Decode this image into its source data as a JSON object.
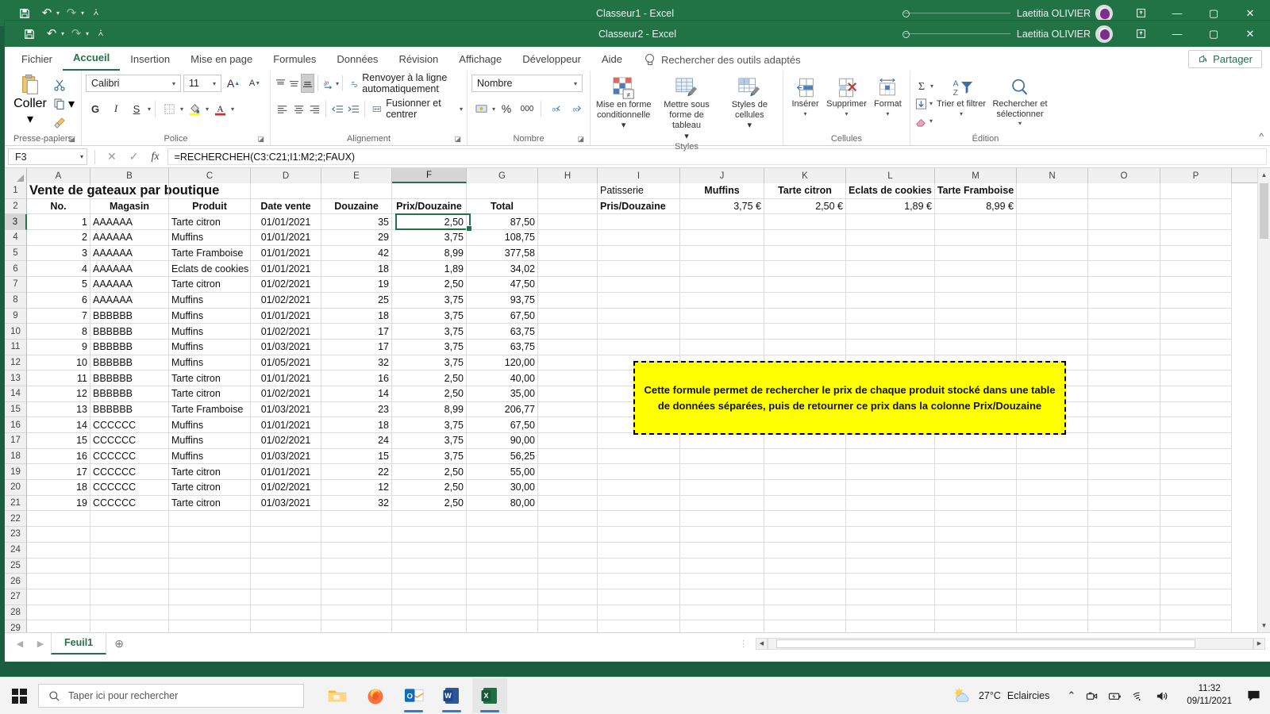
{
  "window_back": {
    "title": "Classeur1  -  Excel",
    "account": "Laetitia OLIVIER"
  },
  "window_front": {
    "title": "Classeur2  -  Excel",
    "account": "Laetitia OLIVIER"
  },
  "qat": {
    "save": "Enregistrer",
    "undo": "Annuler",
    "redo": "Rétablir",
    "more": "Personnaliser la barre d'outils Accès rapide"
  },
  "window_controls": {
    "ribbon_display": "Options d'affichage du ruban",
    "minimize": "Réduire",
    "restore": "Agrandir",
    "close": "Fermer"
  },
  "ribbon": {
    "tabs": [
      {
        "label": "Fichier",
        "active": false
      },
      {
        "label": "Accueil",
        "active": true
      },
      {
        "label": "Insertion",
        "active": false
      },
      {
        "label": "Mise en page",
        "active": false
      },
      {
        "label": "Formules",
        "active": false
      },
      {
        "label": "Données",
        "active": false
      },
      {
        "label": "Révision",
        "active": false
      },
      {
        "label": "Affichage",
        "active": false
      },
      {
        "label": "Développeur",
        "active": false
      },
      {
        "label": "Aide",
        "active": false
      }
    ],
    "tellme": "Rechercher des outils adaptés",
    "share": "Partager",
    "groups": {
      "clipboard": {
        "label": "Presse-papiers",
        "paste": "Coller",
        "cut": "Couper",
        "copy": "Copier",
        "format_painter": "Reproduire la mise en forme"
      },
      "font": {
        "label": "Police",
        "font_name": "Calibri",
        "font_size": "11",
        "grow": "Agrandir la police",
        "shrink": "Réduire la police",
        "bold": "G",
        "italic": "I",
        "underline": "S",
        "borders": "Bordures",
        "fill": "Couleur de remplissage",
        "color": "Couleur de police"
      },
      "alignment": {
        "label": "Alignement",
        "wrap": "Renvoyer à la ligne automatiquement",
        "merge": "Fusionner et centrer",
        "orientation": "Orientation",
        "indent_dec": "Diminuer le retrait",
        "indent_inc": "Augmenter le retrait"
      },
      "number": {
        "label": "Nombre",
        "format": "Nombre",
        "accounting": "Format comptabilité",
        "percent": "%",
        "thousands": "000",
        "dec_add": "Ajouter une décimale",
        "dec_remove": "Réduire les décimales"
      },
      "styles": {
        "label": "Styles",
        "conditional": "Mise en forme conditionnelle",
        "table": "Mettre sous forme de tableau",
        "cell_styles": "Styles de cellules"
      },
      "cells": {
        "label": "Cellules",
        "insert": "Insérer",
        "delete": "Supprimer",
        "format": "Format"
      },
      "editing": {
        "label": "Édition",
        "autosum": "Somme automatique",
        "fill": "Remplissage",
        "clear": "Effacer",
        "sort_filter": "Trier et filtrer",
        "find_select": "Rechercher et sélectionner"
      }
    }
  },
  "formula_bar": {
    "name_box": "F3",
    "cancel": "Annuler",
    "enter": "Entrer",
    "fx": "Insérer une fonction",
    "formula": "=RECHERCHEH(C3:C21;I1:M2;2;FAUX)"
  },
  "grid": {
    "columns": [
      "A",
      "B",
      "C",
      "D",
      "E",
      "F",
      "G",
      "H",
      "I",
      "J",
      "K",
      "L",
      "M",
      "N",
      "O",
      "P"
    ],
    "selected_column": "F",
    "selected_row": 3,
    "selected_cell": "F3",
    "rows": [
      1,
      2,
      3,
      4,
      5,
      6,
      7,
      8,
      9,
      10,
      11,
      12,
      13,
      14,
      15,
      16,
      17,
      18,
      19,
      20,
      21,
      22,
      23,
      24,
      25,
      26,
      27,
      28,
      29
    ],
    "title_cell": "Vente de gateaux par boutique",
    "headers": [
      "No.",
      "Magasin",
      "Produit",
      "Date vente",
      "Douzaine",
      "Prix/Douzaine",
      "Total"
    ],
    "data": [
      [
        "1",
        "AAAAAA",
        "Tarte citron",
        "01/01/2021",
        "35",
        "2,50",
        "87,50"
      ],
      [
        "2",
        "AAAAAA",
        "Muffins",
        "01/01/2021",
        "29",
        "3,75",
        "108,75"
      ],
      [
        "3",
        "AAAAAA",
        "Tarte Framboise",
        "01/01/2021",
        "42",
        "8,99",
        "377,58"
      ],
      [
        "4",
        "AAAAAA",
        "Eclats de cookies",
        "01/01/2021",
        "18",
        "1,89",
        "34,02"
      ],
      [
        "5",
        "AAAAAA",
        "Tarte citron",
        "01/02/2021",
        "19",
        "2,50",
        "47,50"
      ],
      [
        "6",
        "AAAAAA",
        "Muffins",
        "01/02/2021",
        "25",
        "3,75",
        "93,75"
      ],
      [
        "7",
        "BBBBBB",
        "Muffins",
        "01/01/2021",
        "18",
        "3,75",
        "67,50"
      ],
      [
        "8",
        "BBBBBB",
        "Muffins",
        "01/02/2021",
        "17",
        "3,75",
        "63,75"
      ],
      [
        "9",
        "BBBBBB",
        "Muffins",
        "01/03/2021",
        "17",
        "3,75",
        "63,75"
      ],
      [
        "10",
        "BBBBBB",
        "Muffins",
        "01/05/2021",
        "32",
        "3,75",
        "120,00"
      ],
      [
        "11",
        "BBBBBB",
        "Tarte citron",
        "01/01/2021",
        "16",
        "2,50",
        "40,00"
      ],
      [
        "12",
        "BBBBBB",
        "Tarte citron",
        "01/02/2021",
        "14",
        "2,50",
        "35,00"
      ],
      [
        "13",
        "BBBBBB",
        "Tarte Framboise",
        "01/03/2021",
        "23",
        "8,99",
        "206,77"
      ],
      [
        "14",
        "CCCCCC",
        "Muffins",
        "01/01/2021",
        "18",
        "3,75",
        "67,50"
      ],
      [
        "15",
        "CCCCCC",
        "Muffins",
        "01/02/2021",
        "24",
        "3,75",
        "90,00"
      ],
      [
        "16",
        "CCCCCC",
        "Muffins",
        "01/03/2021",
        "15",
        "3,75",
        "56,25"
      ],
      [
        "17",
        "CCCCCC",
        "Tarte citron",
        "01/01/2021",
        "22",
        "2,50",
        "55,00"
      ],
      [
        "18",
        "CCCCCC",
        "Tarte citron",
        "01/02/2021",
        "12",
        "2,50",
        "30,00"
      ],
      [
        "19",
        "CCCCCC",
        "Tarte citron",
        "01/03/2021",
        "32",
        "2,50",
        "80,00"
      ]
    ],
    "lookup_table": {
      "row1": [
        "Patisserie",
        "Muffins",
        "Tarte citron",
        "Eclats de cookies",
        "Tarte Framboise"
      ],
      "row2": [
        "Pris/Douzaine",
        "3,75 €",
        "2,50 €",
        "1,89 €",
        "8,99 €"
      ]
    },
    "annotation": "Cette formule permet de rechercher le prix de chaque produit stocké dans une table de données séparées, puis de retourner ce prix dans la colonne Prix/Douzaine"
  },
  "sheet_bar": {
    "prev": "Feuille précédente",
    "next": "Feuille suivante",
    "tab": "Feuil1",
    "add": "Nouvelle feuille"
  },
  "taskbar": {
    "start": "Démarrer",
    "search_placeholder": "Taper ici pour rechercher",
    "apps": [
      "explorer-icon",
      "firefox-icon",
      "outlook-icon",
      "word-icon",
      "excel-icon"
    ],
    "weather_temp": "27°C",
    "weather_desc": "Eclaircies",
    "time": "11:32",
    "date": "09/11/2021",
    "notifications": "Centre de notifications"
  },
  "colors": {
    "excel_green": "#217346",
    "accent_yellow": "#ffff00",
    "selection": "#217346"
  }
}
